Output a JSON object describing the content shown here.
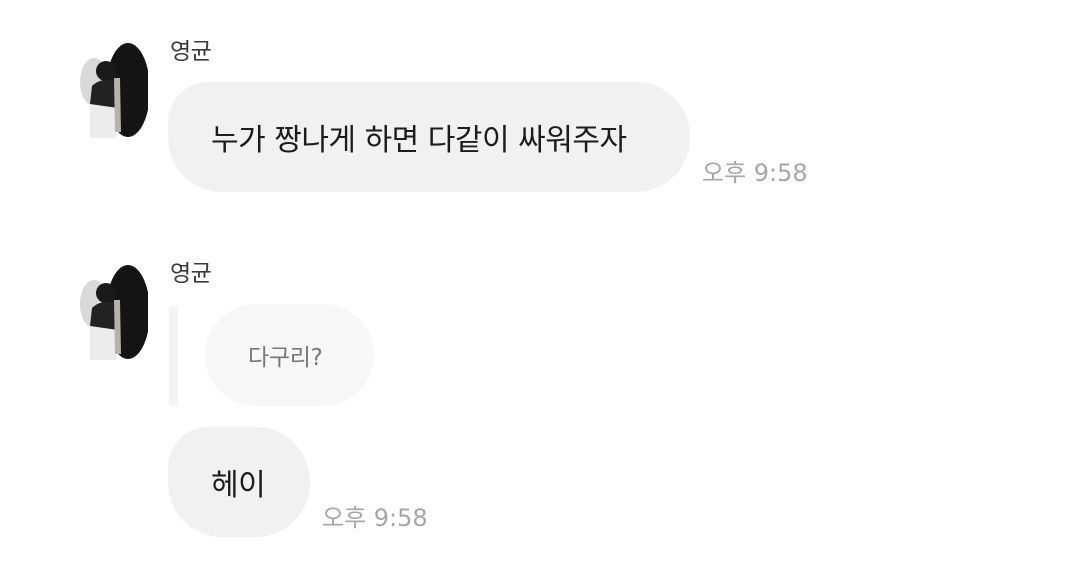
{
  "messages": [
    {
      "sender": "영균",
      "avatar_icon": "profile-photo",
      "text": "누가 짱나게 하면 다같이 싸워주자",
      "time": "오후 9:58"
    },
    {
      "sender": "영균",
      "avatar_icon": "profile-photo",
      "reply_quote": "다구리?",
      "text": "헤이",
      "time": "오후 9:58"
    }
  ],
  "colors": {
    "bubble_bg": "#f1f1f4",
    "quote_bg": "#f7f7f9",
    "time_text": "#a6a6ab",
    "sender_text": "#3a3a3a"
  }
}
